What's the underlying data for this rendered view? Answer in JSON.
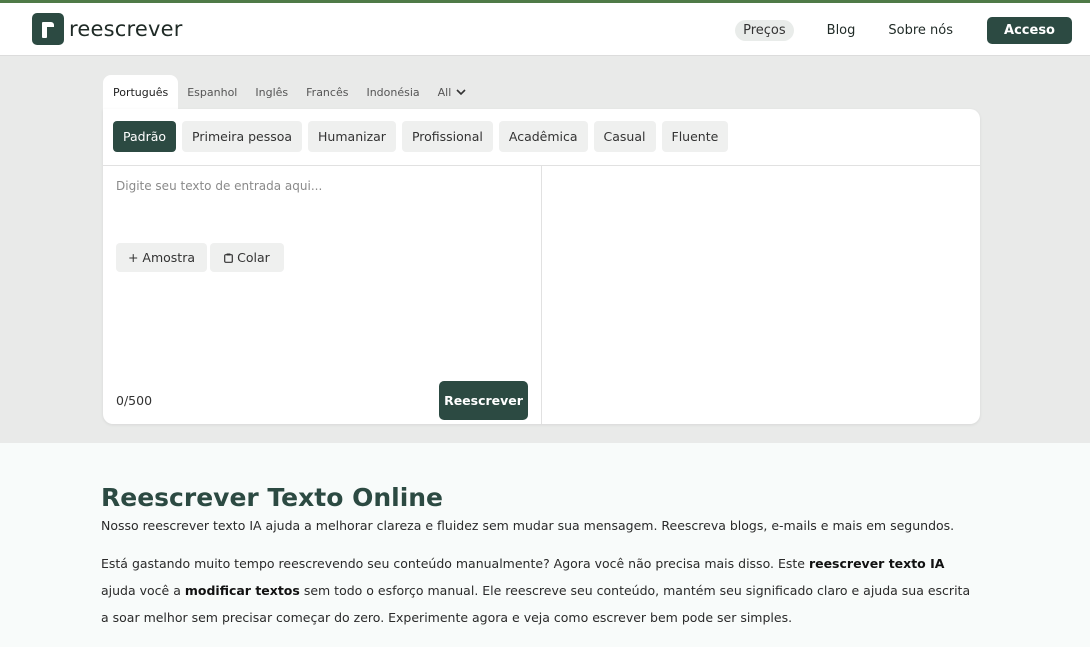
{
  "header": {
    "logo_text": "reescrever",
    "nav": {
      "pricing": "Preços",
      "blog": "Blog",
      "about": "Sobre nós",
      "login": "Acceso"
    }
  },
  "languages": {
    "items": [
      "Português",
      "Espanhol",
      "Inglês",
      "Francês",
      "Indonésia"
    ],
    "all_label": "All",
    "active": "Português"
  },
  "modes": {
    "items": [
      "Padrão",
      "Primeira pessoa",
      "Humanizar",
      "Profissional",
      "Acadêmica",
      "Casual",
      "Fluente"
    ],
    "active": "Padrão"
  },
  "editor": {
    "placeholder": "Digite seu texto de entrada aqui...",
    "sample_label": "+ Amostra",
    "paste_label": "Colar",
    "counter": "0/500",
    "rewrite_label": "Reescrever"
  },
  "content": {
    "title": "Reescrever Texto Online",
    "lead": "Nosso reescrever texto IA ajuda a melhorar clareza e fluidez sem mudar sua mensagem. Reescreva blogs, e-mails e mais em segundos.",
    "p1_a": "Está gastando muito tempo reescrevendo seu conteúdo manualmente? Agora você não precisa mais disso. Este ",
    "p1_b": "reescrever texto IA",
    "p1_c": " ajuda você a ",
    "p1_d": "modificar textos",
    "p1_e": " sem todo o esforço manual. Ele reescreve seu conteúdo, mantém seu significado claro e ajuda sua escrita a soar melhor sem precisar começar do zero. Experimente agora e veja como escrever bem pode ser simples."
  },
  "colors": {
    "brand": "#2c4a42",
    "accent_line": "#4f7a47",
    "band": "#e9eae9"
  }
}
